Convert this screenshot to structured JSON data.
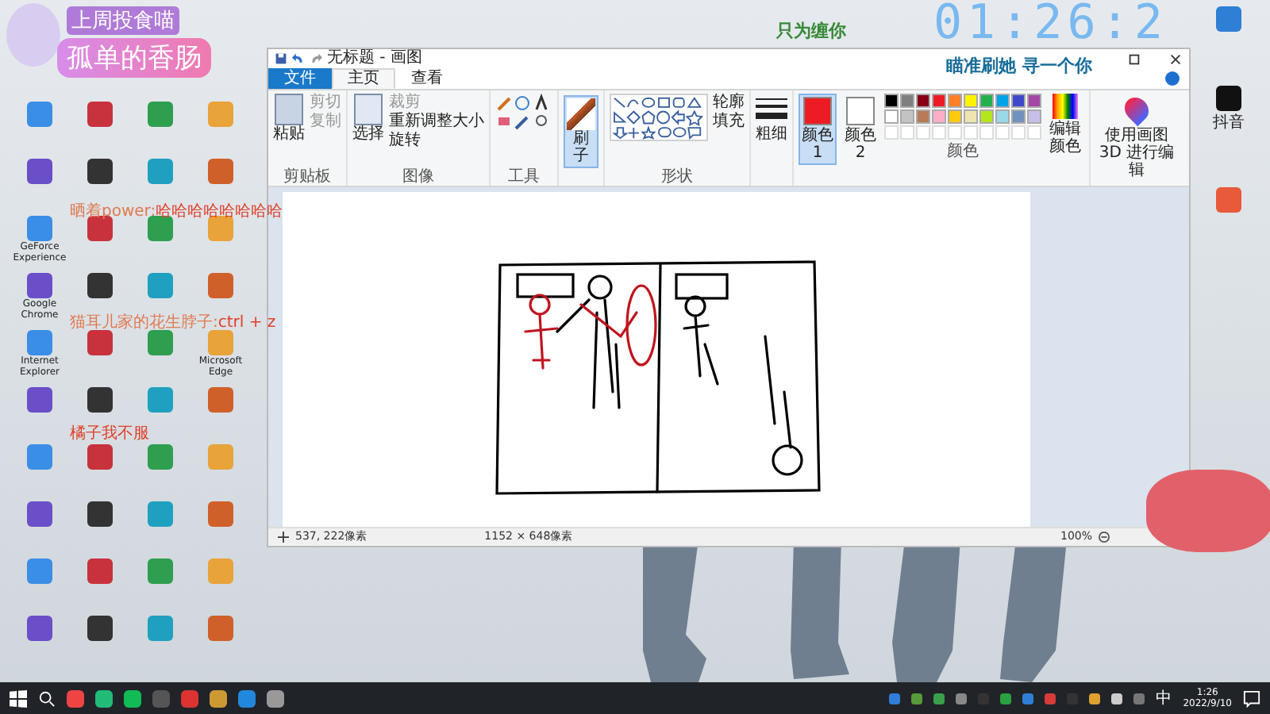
{
  "overlay": {
    "subtitle": "上周投食喵",
    "title": "孤单的香肠"
  },
  "wallpaper_text": "只为缠你",
  "clock": "01:26:2",
  "banner": "瞄准刷她 寻一个你",
  "desktop_icons": [
    {
      "label": "GeForce Experience"
    },
    {
      "label": "Google Chrome"
    },
    {
      "label": "Internet Explorer"
    },
    {
      "label": "Microsoft Edge"
    }
  ],
  "right_icons": [
    {
      "label": "抖音"
    }
  ],
  "chat": [
    {
      "user": "晒着power:",
      "text": "哈哈哈哈哈哈哈哈"
    },
    {
      "user": "猫耳儿家的花生脖子:",
      "text": "ctrl + z"
    },
    {
      "text": "橘子我不服"
    }
  ],
  "paint": {
    "title": "无标题 - 画图",
    "file_menu": "文件",
    "tabs": [
      {
        "label": "主页",
        "selected": true
      },
      {
        "label": "查看",
        "selected": false
      }
    ],
    "clipboard": {
      "paste": "粘贴",
      "cut": "剪切",
      "copy": "复制",
      "label": "剪贴板"
    },
    "image": {
      "select": "选择",
      "crop": "裁剪",
      "resize": "重新调整大小",
      "rotate": "旋转",
      "label": "图像"
    },
    "tools": {
      "label": "工具"
    },
    "brush": {
      "label": "刷子",
      "selected": true
    },
    "shapes": {
      "outline": "轮廓",
      "fill": "填充",
      "label": "形状"
    },
    "size": {
      "label": "粗细"
    },
    "color1": {
      "label": "颜色 1",
      "color": "#ed1c24",
      "selected": true
    },
    "color2": {
      "label": "颜色 2",
      "color": "#ffffff",
      "selected": false
    },
    "palette": {
      "label": "颜色",
      "colors": [
        {
          "color": "#000000"
        },
        {
          "color": "#7f7f7f"
        },
        {
          "color": "#880015"
        },
        {
          "color": "#ed1c24"
        },
        {
          "color": "#ff7f27"
        },
        {
          "color": "#fff200"
        },
        {
          "color": "#22b14c"
        },
        {
          "color": "#00a2e8"
        },
        {
          "color": "#3f48cc"
        },
        {
          "color": "#a349a4"
        },
        {
          "color": "#ffffff"
        },
        {
          "color": "#c3c3c3"
        },
        {
          "color": "#b97a57"
        },
        {
          "color": "#ffaec9"
        },
        {
          "color": "#ffc90e"
        },
        {
          "color": "#efe4b0"
        },
        {
          "color": "#b5e61d"
        },
        {
          "color": "#99d9ea"
        },
        {
          "color": "#7092be"
        },
        {
          "color": "#c8bfe7"
        }
      ]
    },
    "edit_colors": "编辑颜色",
    "paint3d": "使用画图 3D 进行编辑",
    "status": {
      "cursor": "537, 222像素",
      "size": "1152 × 648像素",
      "zoom": "100%"
    }
  },
  "taskbar": {
    "ime": "中",
    "time": "1:26",
    "date": "2022/9/10"
  }
}
